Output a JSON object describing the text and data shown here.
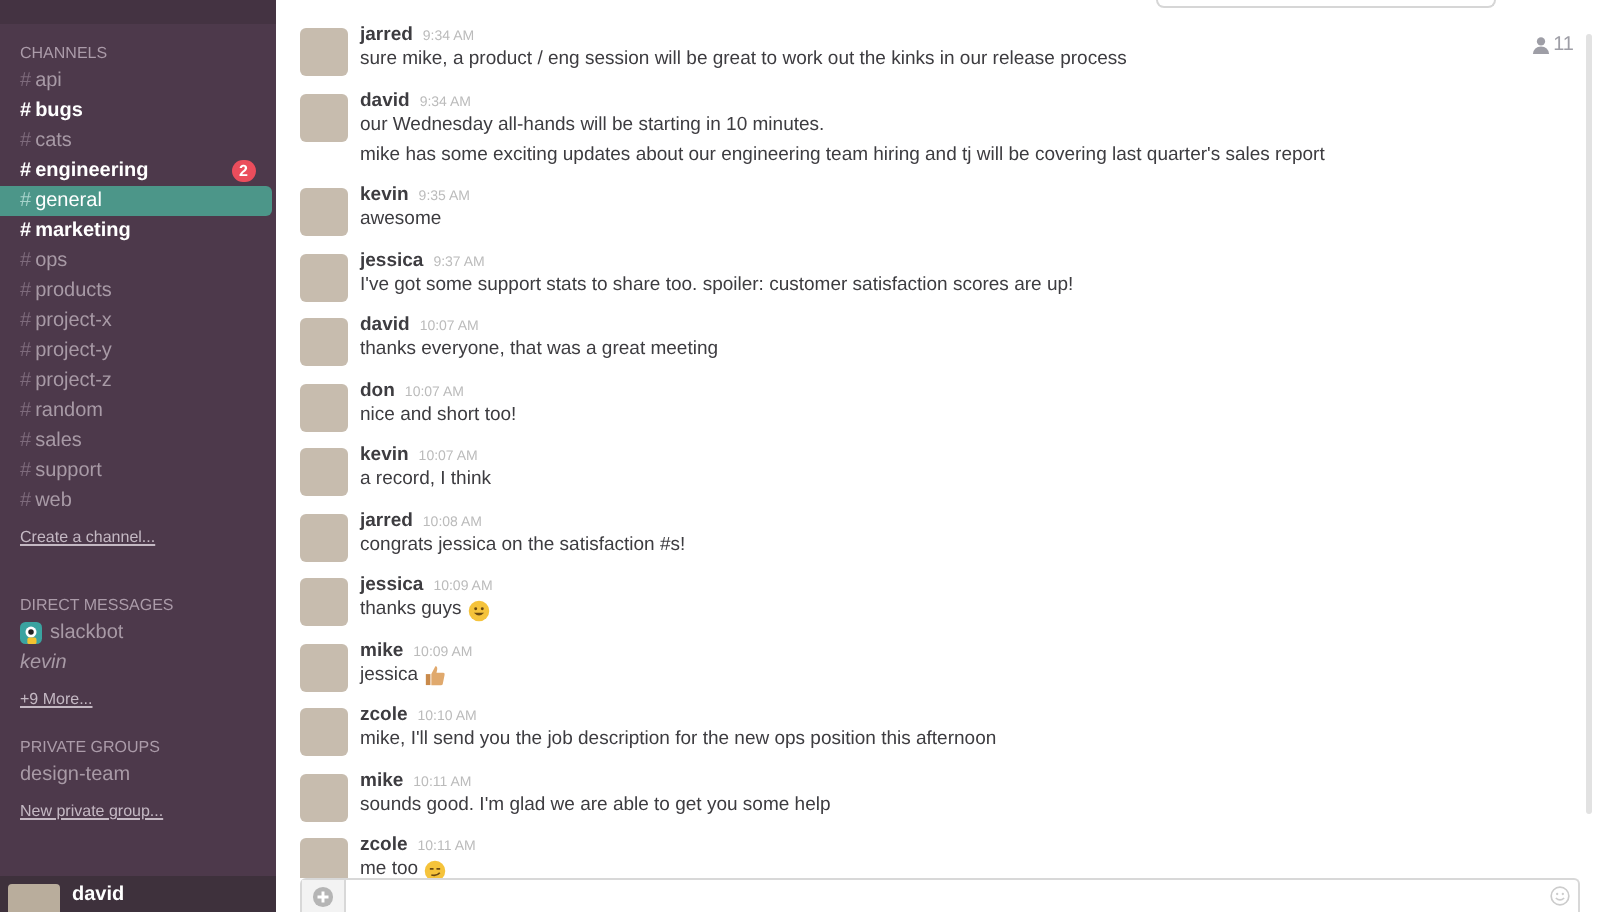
{
  "sidebar": {
    "channels_header": "CHANNELS",
    "channels": [
      {
        "sigil": "#",
        "name": "api",
        "unread": false,
        "selected": false
      },
      {
        "sigil": "#",
        "name": "bugs",
        "unread": true,
        "selected": false
      },
      {
        "sigil": "#",
        "name": "cats",
        "unread": false,
        "selected": false
      },
      {
        "sigil": "#",
        "name": "engineering",
        "unread": true,
        "selected": false,
        "badge": "2"
      },
      {
        "sigil": "#",
        "name": "general",
        "unread": false,
        "selected": true
      },
      {
        "sigil": "#",
        "name": "marketing",
        "unread": true,
        "selected": false
      },
      {
        "sigil": "#",
        "name": "ops",
        "unread": false,
        "selected": false
      },
      {
        "sigil": "#",
        "name": "products",
        "unread": false,
        "selected": false
      },
      {
        "sigil": "#",
        "name": "project-x",
        "unread": false,
        "selected": false
      },
      {
        "sigil": "#",
        "name": "project-y",
        "unread": false,
        "selected": false
      },
      {
        "sigil": "#",
        "name": "project-z",
        "unread": false,
        "selected": false
      },
      {
        "sigil": "#",
        "name": "random",
        "unread": false,
        "selected": false
      },
      {
        "sigil": "#",
        "name": "sales",
        "unread": false,
        "selected": false
      },
      {
        "sigil": "#",
        "name": "support",
        "unread": false,
        "selected": false
      },
      {
        "sigil": "#",
        "name": "web",
        "unread": false,
        "selected": false
      }
    ],
    "create_channel": "Create a channel...",
    "dm_header": "DIRECT MESSAGES",
    "direct_messages": [
      {
        "kind": "bot",
        "name": "slackbot",
        "away": false
      },
      {
        "kind": "user",
        "name": "kevin",
        "away": true
      }
    ],
    "more_link": "+9 More...",
    "groups_header": "PRIVATE GROUPS",
    "groups": [
      {
        "name": "design-team",
        "selected": false
      }
    ],
    "new_group": "New private group...",
    "user": {
      "name": "david"
    }
  },
  "members": {
    "count": "11"
  },
  "messages": [
    {
      "author": "jarred",
      "time": "9:34 AM",
      "lines": [
        {
          "text": "sure mike, a product / eng session will be great to work out the kinks in our release process"
        }
      ]
    },
    {
      "author": "david",
      "time": "9:34 AM",
      "lines": [
        {
          "text": "our Wednesday all-hands will be starting in 10 minutes."
        },
        {
          "text": "mike has some exciting updates about our engineering team hiring and tj will be covering last quarter's sales report"
        }
      ]
    },
    {
      "author": "kevin",
      "time": "9:35 AM",
      "lines": [
        {
          "text": "awesome"
        }
      ]
    },
    {
      "author": "jessica",
      "time": "9:37 AM",
      "lines": [
        {
          "text": "I've got some support stats to share too. spoiler: customer satisfaction scores are up!"
        }
      ]
    },
    {
      "author": "david",
      "time": "10:07 AM",
      "lines": [
        {
          "text": "thanks everyone, that was a great meeting"
        }
      ]
    },
    {
      "author": "don",
      "time": "10:07 AM",
      "lines": [
        {
          "text": "nice and short too!"
        }
      ]
    },
    {
      "author": "kevin",
      "time": "10:07 AM",
      "lines": [
        {
          "text": "a record, I think"
        }
      ]
    },
    {
      "author": "jarred",
      "time": "10:08 AM",
      "lines": [
        {
          "text": "congrats jessica on the satisfaction #s!"
        }
      ]
    },
    {
      "author": "jessica",
      "time": "10:09 AM",
      "lines": [
        {
          "text": "thanks guys",
          "kind": "smile"
        }
      ]
    },
    {
      "author": "mike",
      "time": "10:09 AM",
      "lines": [
        {
          "text": "jessica",
          "kind": "thumbs-up"
        }
      ]
    },
    {
      "author": "zcole",
      "time": "10:10 AM",
      "lines": [
        {
          "text": "mike, I'll send you the job description for the new ops position this afternoon"
        }
      ]
    },
    {
      "author": "mike",
      "time": "10:11 AM",
      "lines": [
        {
          "text": "sounds good. I'm glad we are able to get you some help"
        }
      ]
    },
    {
      "author": "zcole",
      "time": "10:11 AM",
      "lines": [
        {
          "text": "me too",
          "kind": "smirk"
        }
      ]
    }
  ]
}
